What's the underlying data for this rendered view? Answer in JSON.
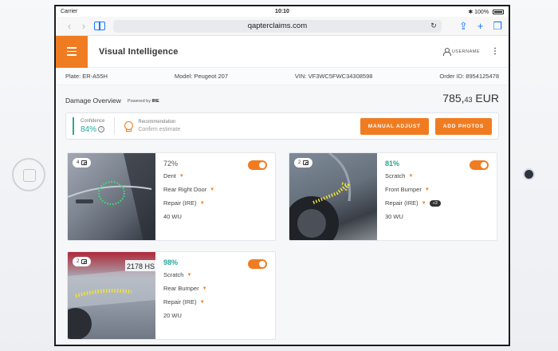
{
  "status_bar": {
    "carrier": "Carrier",
    "time": "10:10",
    "battery": "100%"
  },
  "browser": {
    "url": "qapterclaims.com"
  },
  "header": {
    "title": "Visual Intelligence",
    "user_label": "USERNAME"
  },
  "info": {
    "plate": "Plate: ER-A55H",
    "model": "Model: Peugeot 207",
    "vin": "VIN:  VF3WC5FWC34308598",
    "order": "Order ID: 8954125478"
  },
  "overview": {
    "title": "Damage Overview",
    "powered_by": "Powered by",
    "powered_brand": "IRE",
    "price_main": "785,",
    "price_cents": "43",
    "price_currency": " EUR"
  },
  "confidence": {
    "label": "Confidence",
    "value": "84%",
    "recommendation_label": "Recommendation",
    "recommendation_value": "Confirm estimate"
  },
  "buttons": {
    "manual_adjust": "MANUAL ADJUST",
    "add_photos": "ADD PHOTOS"
  },
  "cards": [
    {
      "photos": "4",
      "confidence": "72%",
      "damage": "Dent",
      "part": "Rear Right Door",
      "action": "Repair (IRE)",
      "extra": "",
      "wu": "40 WU"
    },
    {
      "photos": "2",
      "confidence": "81%",
      "damage": "Scratch",
      "part": "Front Bumper",
      "action": "Repair (IRE)",
      "extra": "+2",
      "wu": "30 WU"
    },
    {
      "photos": "2",
      "confidence": "98%",
      "damage": "Scratch",
      "part": "Rear Bumper",
      "action": "Repair (IRE)",
      "extra": "",
      "wu": "20 WU",
      "plate_text": "2178 HS"
    }
  ],
  "colors": {
    "accent": "#f07c22",
    "teal": "#26a69a"
  }
}
